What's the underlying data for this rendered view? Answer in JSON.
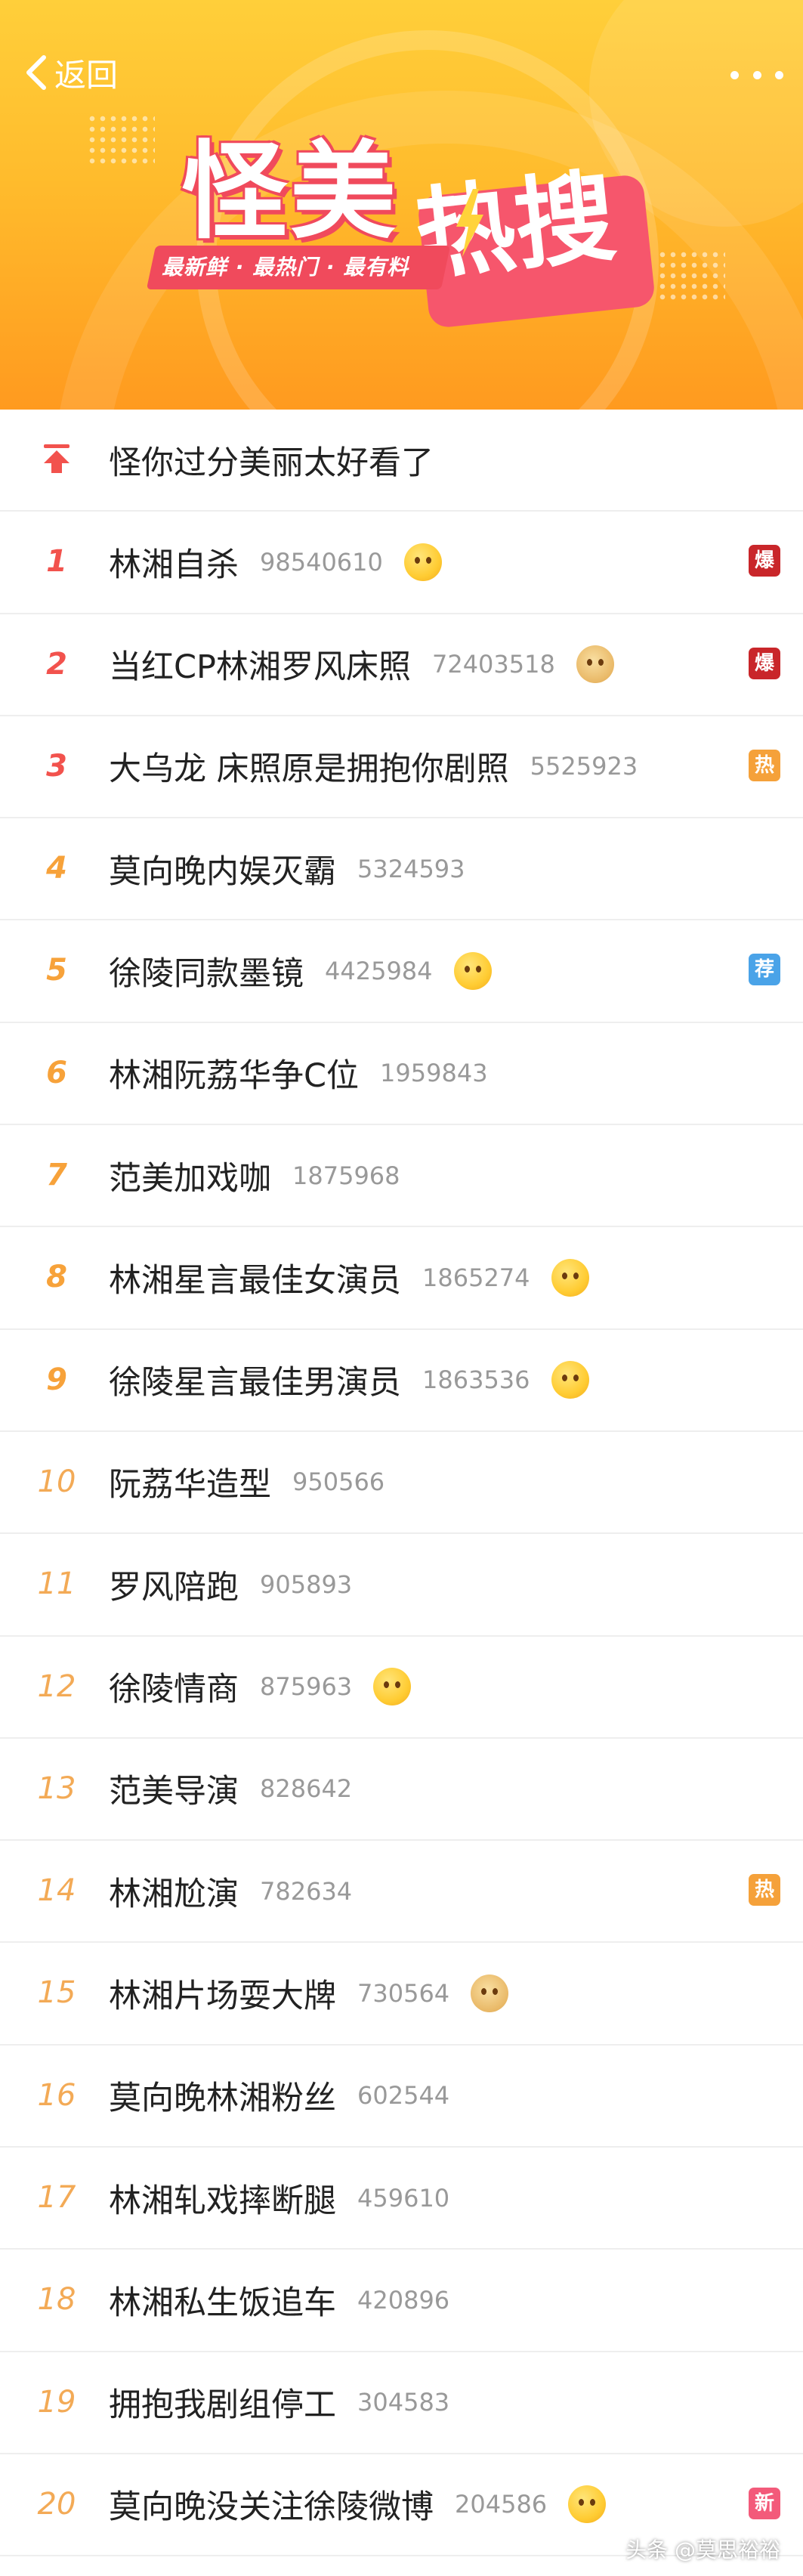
{
  "header": {
    "back_label": "返回",
    "title_main": "怪美",
    "title_accent": "热搜",
    "slogan": "最新鲜 · 最热门 · 最有料"
  },
  "pinned": {
    "title": "怪你过分美丽太好看了",
    "icon": "pin-top-icon"
  },
  "items": [
    {
      "rank": "1",
      "title": "林湘自杀",
      "count": "98540610",
      "emoji": "grimacing-emoji",
      "badge": "爆"
    },
    {
      "rank": "2",
      "title": "当红CP林湘罗风床照",
      "count": "72403518",
      "emoji": "doge-emoji",
      "badge": "爆"
    },
    {
      "rank": "3",
      "title": "大乌龙 床照原是拥抱你剧照",
      "count": "5525923",
      "emoji": "",
      "badge": "热"
    },
    {
      "rank": "4",
      "title": "莫向晚内娱灭霸",
      "count": "5324593",
      "emoji": "",
      "badge": ""
    },
    {
      "rank": "5",
      "title": "徐陵同款墨镜",
      "count": "4425984",
      "emoji": "shocked-emoji",
      "badge": "荐"
    },
    {
      "rank": "6",
      "title": "林湘阮荔华争C位",
      "count": "1959843",
      "emoji": "",
      "badge": ""
    },
    {
      "rank": "7",
      "title": "范美加戏咖",
      "count": "1875968",
      "emoji": "",
      "badge": ""
    },
    {
      "rank": "8",
      "title": "林湘星言最佳女演员",
      "count": "1865274",
      "emoji": "shush-emoji",
      "badge": ""
    },
    {
      "rank": "9",
      "title": "徐陵星言最佳男演员",
      "count": "1863536",
      "emoji": "shush-emoji",
      "badge": ""
    },
    {
      "rank": "10",
      "title": "阮荔华造型",
      "count": "950566",
      "emoji": "",
      "badge": ""
    },
    {
      "rank": "11",
      "title": "罗风陪跑",
      "count": "905893",
      "emoji": "",
      "badge": ""
    },
    {
      "rank": "12",
      "title": "徐陵情商",
      "count": "875963",
      "emoji": "tongue-emoji",
      "badge": ""
    },
    {
      "rank": "13",
      "title": "范美导演",
      "count": "828642",
      "emoji": "",
      "badge": ""
    },
    {
      "rank": "14",
      "title": "林湘尬演",
      "count": "782634",
      "emoji": "",
      "badge": "热"
    },
    {
      "rank": "15",
      "title": "林湘片场耍大牌",
      "count": "730564",
      "emoji": "doge-emoji",
      "badge": ""
    },
    {
      "rank": "16",
      "title": "莫向晚林湘粉丝",
      "count": "602544",
      "emoji": "",
      "badge": ""
    },
    {
      "rank": "17",
      "title": "林湘轧戏摔断腿",
      "count": "459610",
      "emoji": "",
      "badge": ""
    },
    {
      "rank": "18",
      "title": "林湘私生饭追车",
      "count": "420896",
      "emoji": "",
      "badge": ""
    },
    {
      "rank": "19",
      "title": "拥抱我剧组停工",
      "count": "304583",
      "emoji": "",
      "badge": ""
    },
    {
      "rank": "20",
      "title": "莫向晚没关注徐陵微博",
      "count": "204586",
      "emoji": "laugh-cry-emoji",
      "badge": "新"
    }
  ],
  "watermark": "头条 @莫思裕裕",
  "colors": {
    "banner_top": "#ffcf3a",
    "banner_bottom": "#ff9a1f",
    "accent_pink": "#f04a5c",
    "rank_top3": "#f2524d",
    "rank_other": "#f7a23a",
    "badge_bao": "#c9262a",
    "badge_re": "#f5a13a",
    "badge_jian": "#4aa3e8",
    "badge_xin": "#f35a7a"
  }
}
